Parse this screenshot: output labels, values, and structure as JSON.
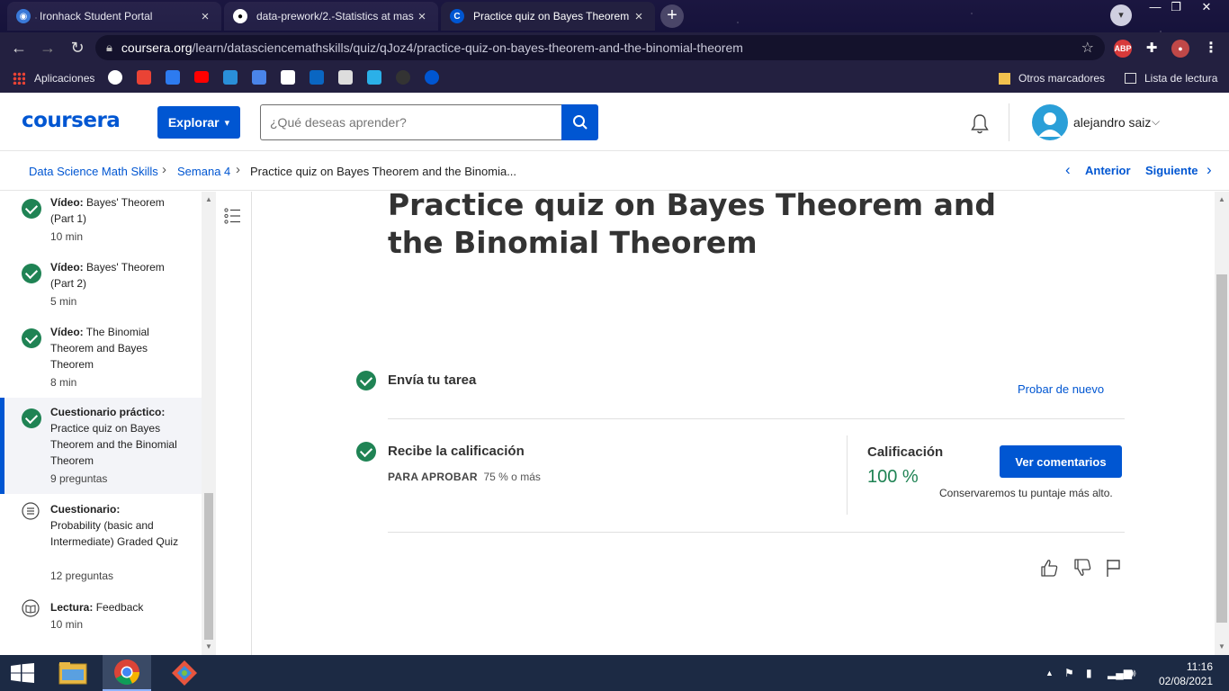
{
  "browser": {
    "tabs": [
      {
        "title": "Ironhack Student Portal",
        "close": "×"
      },
      {
        "title": "data-prework/2.-Statistics at mas",
        "close": "×"
      },
      {
        "title": "Practice quiz on Bayes Theorem a",
        "close": "×"
      }
    ],
    "new_tab": "+",
    "window_controls": [
      "—",
      "❐",
      "✕"
    ],
    "url_host": "coursera.org",
    "url_path": "/learn/datasciencemathskills/quiz/qJoz4/practice-quiz-on-bayes-theorem-and-the-binomial-theorem",
    "abp_label": "ABP",
    "bookmarks": {
      "apps_label": "Aplicaciones",
      "other_label": "Otros marcadores",
      "reading_list_label": "Lista de lectura"
    }
  },
  "header": {
    "logo": "coursera",
    "explore_label": "Explorar",
    "search_placeholder": "¿Qué deseas aprender?",
    "user_name": "alejandro saiz"
  },
  "breadcrumb": {
    "items": [
      "Data Science Math Skills",
      "Semana 4",
      "Practice quiz on Bayes Theorem and the Binomia..."
    ],
    "prev_label": "Anterior",
    "next_label": "Siguiente"
  },
  "sidebar": {
    "items": [
      {
        "kind": "Vídeo:",
        "name": "Bayes' Theorem (Part 1)",
        "meta": "10 min"
      },
      {
        "kind": "Vídeo:",
        "name": "Bayes' Theorem (Part 2)",
        "meta": "5 min"
      },
      {
        "kind": "Vídeo:",
        "name": "The Binomial Theorem and Bayes Theorem",
        "meta": "8 min"
      },
      {
        "kind": "Cuestionario práctico:",
        "name": "Practice quiz on Bayes Theorem and the Binomial Theorem",
        "meta": "9 preguntas"
      },
      {
        "kind": "Cuestionario:",
        "name": "Probability (basic and Intermediate) Graded Quiz",
        "meta": "12 preguntas"
      },
      {
        "kind": "Lectura:",
        "name": "Feedback",
        "meta": "10 min"
      }
    ]
  },
  "main": {
    "title": "Practice quiz on Bayes Theorem and the Binomial Theorem",
    "submit": {
      "label": "Envía tu tarea",
      "retry_label": "Probar de nuevo"
    },
    "grade_step": {
      "label": "Recibe la calificación",
      "pass_label": "PARA APROBAR",
      "pass_value": "75 % o más",
      "grade_label": "Calificación",
      "grade_value": "100 %",
      "feedback_button": "Ver comentarios",
      "keep_note": "Conservaremos tu puntaje más alto."
    }
  },
  "taskbar": {
    "time": "11:16",
    "date": "02/08/2021"
  },
  "colors": {
    "brand": "#0056d2",
    "success": "#1f8354",
    "chrome_dark": "#232040"
  }
}
